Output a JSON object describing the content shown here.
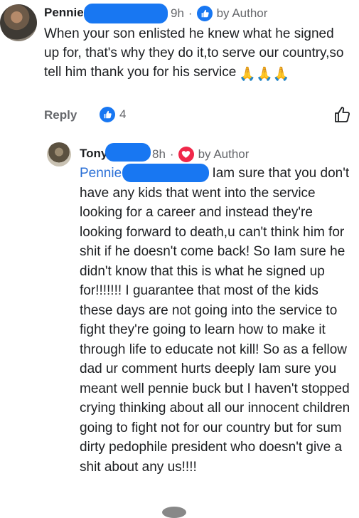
{
  "comment": {
    "author": "Pennie",
    "time": "9h",
    "author_badge": "by Author",
    "text": "When your son enlisted he knew what he signed up for, that's why they do it,to serve our country,so tell him thank you for his service",
    "emoji": "🙏🙏🙏",
    "reply_label": "Reply",
    "reaction_count": "4"
  },
  "reply": {
    "author": "Tony",
    "time": "8h",
    "author_badge": "by Author",
    "mention": "Pennie",
    "text": "Iam sure that you don't have any kids that went into the service looking for a career and instead they're looking forward to death,u can't think him for shit if he doesn't come back! So Iam sure he didn't  know that this is what he signed up for!!!!!!! I guarantee that most of the kids these days are not going into the service to fight they're going to learn how to make it through life to educate not kill! So as a fellow dad ur comment hurts deeply Iam sure you meant well pennie buck but I haven't stopped crying thinking about all our innocent children going to fight not for our country but for sum dirty pedophile president who doesn't give a shit about any us!!!!"
  },
  "colors": {
    "redaction": "#1877f2",
    "like_badge": "#1877f2",
    "love_badge": "#f0284a",
    "mention": "#2a6fd6",
    "meta_gray": "#65676b"
  },
  "icons": [
    "like-thumb-icon",
    "heart-icon",
    "thumbs-up-outline-icon",
    "praying-hands-emoji"
  ]
}
